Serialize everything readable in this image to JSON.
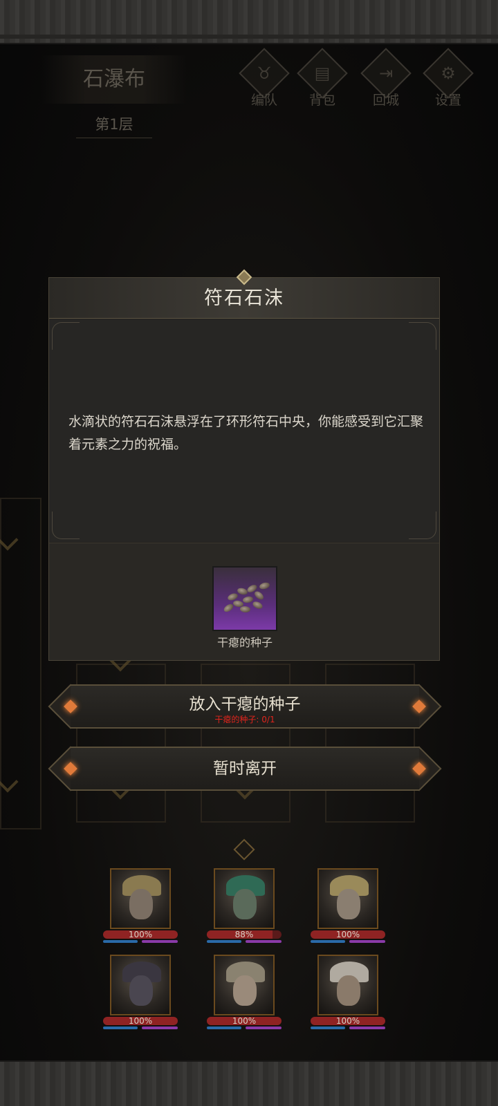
{
  "header": {
    "location": "石瀑布",
    "floor": "第1层",
    "buttons": [
      {
        "icon": "horned-skull-icon",
        "label": "编队"
      },
      {
        "icon": "bag-icon",
        "label": "背包"
      },
      {
        "icon": "door-exit-icon",
        "label": "回城"
      },
      {
        "icon": "gear-icon",
        "label": "设置"
      }
    ]
  },
  "modal": {
    "title": "符石石沫",
    "description": "水滴状的符石石沫悬浮在了环形符石中央，你能感受到它汇聚着元素之力的祝福。",
    "item": {
      "name": "干瘪的种子",
      "icon": "seeds-icon",
      "rarity_color": "#7c3aa8"
    }
  },
  "actions": {
    "place": {
      "label": "放入干瘪的种子",
      "requirement": "干瘪的种子: 0/1",
      "requirement_color": "#e0241c"
    },
    "leave": {
      "label": "暂时离开"
    }
  },
  "party": [
    {
      "hp_text": "100%",
      "hp": 1.0
    },
    {
      "hp_text": "88%",
      "hp": 0.88
    },
    {
      "hp_text": "100%",
      "hp": 1.0
    },
    {
      "hp_text": "100%",
      "hp": 1.0
    },
    {
      "hp_text": "100%",
      "hp": 1.0
    },
    {
      "hp_text": "100%",
      "hp": 1.0
    }
  ],
  "colors": {
    "accent_gold": "#c9b98a",
    "gem_orange": "#e07a3a",
    "hp_red": "#8f2323",
    "mp_blue": "#2a6aa8",
    "mp_purple": "#8a3aa8"
  }
}
